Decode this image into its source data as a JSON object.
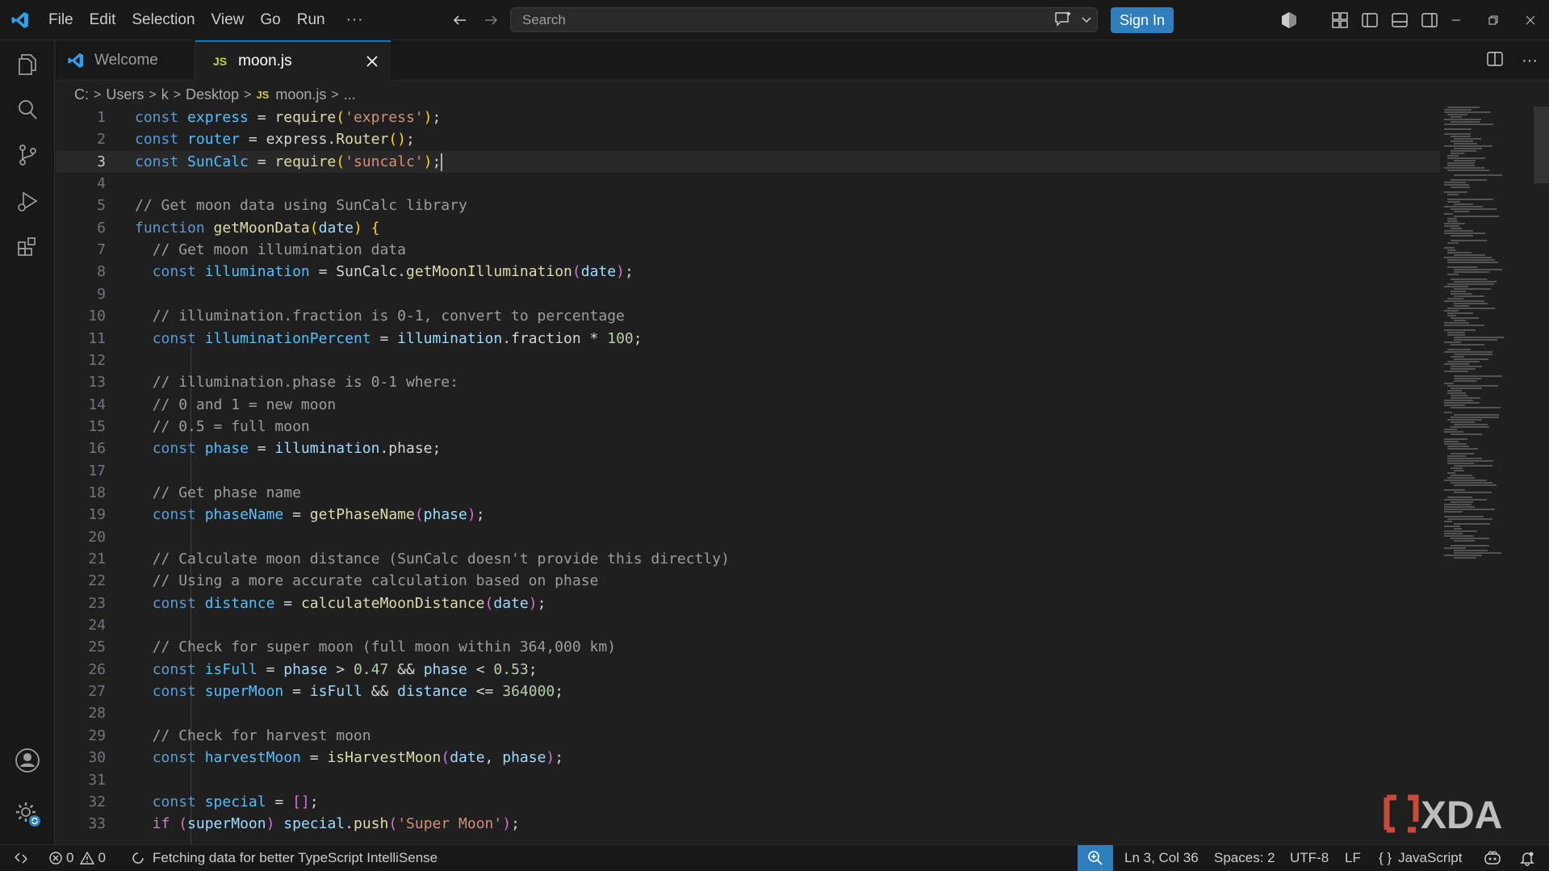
{
  "menu": {
    "items": [
      "File",
      "Edit",
      "Selection",
      "View",
      "Go",
      "Run"
    ],
    "more": "···"
  },
  "search": {
    "placeholder": "Search"
  },
  "signin_label": "Sign In",
  "tabs": {
    "welcome": {
      "label": "Welcome"
    },
    "active": {
      "label": "moon.js",
      "badge": "JS"
    }
  },
  "breadcrumb": {
    "parts": [
      "C:",
      "Users",
      "k",
      "Desktop"
    ],
    "file": "moon.js",
    "file_badge": "JS",
    "trail": "..."
  },
  "editor": {
    "current_line": 3,
    "lines": [
      [
        [
          "kw",
          "const "
        ],
        [
          "var",
          "express"
        ],
        [
          "pl",
          " = "
        ],
        [
          "fn",
          "require"
        ],
        [
          "br",
          "("
        ],
        [
          "str",
          "'express'"
        ],
        [
          "br",
          ")"
        ],
        [
          "pl",
          ";"
        ]
      ],
      [
        [
          "kw",
          "const "
        ],
        [
          "var",
          "router"
        ],
        [
          "pl",
          " = express."
        ],
        [
          "fn",
          "Router"
        ],
        [
          "br",
          "()"
        ],
        [
          "pl",
          ";"
        ]
      ],
      [
        [
          "kw",
          "const "
        ],
        [
          "var",
          "SunCalc"
        ],
        [
          "pl",
          " = "
        ],
        [
          "fn",
          "require"
        ],
        [
          "br",
          "("
        ],
        [
          "str",
          "'suncalc'"
        ],
        [
          "br",
          ")"
        ],
        [
          "pl",
          ";"
        ]
      ],
      [],
      [
        [
          "cm",
          "// Get moon data using SunCalc library"
        ]
      ],
      [
        [
          "kw",
          "function "
        ],
        [
          "fn",
          "getMoonData"
        ],
        [
          "br",
          "("
        ],
        [
          "prop",
          "date"
        ],
        [
          "br",
          ") {"
        ]
      ],
      [
        [
          "pl",
          "  "
        ],
        [
          "cm",
          "// Get moon illumination data"
        ]
      ],
      [
        [
          "pl",
          "  "
        ],
        [
          "kw",
          "const "
        ],
        [
          "var",
          "illumination"
        ],
        [
          "pl",
          " = SunCalc."
        ],
        [
          "fn",
          "getMoonIllumination"
        ],
        [
          "br2",
          "("
        ],
        [
          "prop",
          "date"
        ],
        [
          "br2",
          ")"
        ],
        [
          "pl",
          ";"
        ]
      ],
      [],
      [
        [
          "pl",
          "  "
        ],
        [
          "cm",
          "// illumination.fraction is 0-1, convert to percentage"
        ]
      ],
      [
        [
          "pl",
          "  "
        ],
        [
          "kw",
          "const "
        ],
        [
          "var",
          "illuminationPercent"
        ],
        [
          "pl",
          " = "
        ],
        [
          "prop",
          "illumination"
        ],
        [
          "pl",
          ".fraction * "
        ],
        [
          "num",
          "100"
        ],
        [
          "pl",
          ";"
        ]
      ],
      [],
      [
        [
          "pl",
          "  "
        ],
        [
          "cm",
          "// illumination.phase is 0-1 where:"
        ]
      ],
      [
        [
          "pl",
          "  "
        ],
        [
          "cm",
          "// 0 and 1 = new moon"
        ]
      ],
      [
        [
          "pl",
          "  "
        ],
        [
          "cm",
          "// 0.5 = full moon"
        ]
      ],
      [
        [
          "pl",
          "  "
        ],
        [
          "kw",
          "const "
        ],
        [
          "var",
          "phase"
        ],
        [
          "pl",
          " = "
        ],
        [
          "prop",
          "illumination"
        ],
        [
          "pl",
          ".phase;"
        ]
      ],
      [],
      [
        [
          "pl",
          "  "
        ],
        [
          "cm",
          "// Get phase name"
        ]
      ],
      [
        [
          "pl",
          "  "
        ],
        [
          "kw",
          "const "
        ],
        [
          "var",
          "phaseName"
        ],
        [
          "pl",
          " = "
        ],
        [
          "fn",
          "getPhaseName"
        ],
        [
          "br2",
          "("
        ],
        [
          "prop",
          "phase"
        ],
        [
          "br2",
          ")"
        ],
        [
          "pl",
          ";"
        ]
      ],
      [],
      [
        [
          "pl",
          "  "
        ],
        [
          "cm",
          "// Calculate moon distance (SunCalc doesn't provide this directly)"
        ]
      ],
      [
        [
          "pl",
          "  "
        ],
        [
          "cm",
          "// Using a more accurate calculation based on phase"
        ]
      ],
      [
        [
          "pl",
          "  "
        ],
        [
          "kw",
          "const "
        ],
        [
          "var",
          "distance"
        ],
        [
          "pl",
          " = "
        ],
        [
          "fn",
          "calculateMoonDistance"
        ],
        [
          "br2",
          "("
        ],
        [
          "prop",
          "date"
        ],
        [
          "br2",
          ")"
        ],
        [
          "pl",
          ";"
        ]
      ],
      [],
      [
        [
          "pl",
          "  "
        ],
        [
          "cm",
          "// Check for super moon (full moon within 364,000 km)"
        ]
      ],
      [
        [
          "pl",
          "  "
        ],
        [
          "kw",
          "const "
        ],
        [
          "var",
          "isFull"
        ],
        [
          "pl",
          " = "
        ],
        [
          "prop",
          "phase"
        ],
        [
          "pl",
          " > "
        ],
        [
          "num",
          "0.47"
        ],
        [
          "pl",
          " && "
        ],
        [
          "prop",
          "phase"
        ],
        [
          "pl",
          " < "
        ],
        [
          "num",
          "0.53"
        ],
        [
          "pl",
          ";"
        ]
      ],
      [
        [
          "pl",
          "  "
        ],
        [
          "kw",
          "const "
        ],
        [
          "var",
          "superMoon"
        ],
        [
          "pl",
          " = "
        ],
        [
          "prop",
          "isFull"
        ],
        [
          "pl",
          " && "
        ],
        [
          "prop",
          "distance"
        ],
        [
          "pl",
          " <= "
        ],
        [
          "num",
          "364000"
        ],
        [
          "pl",
          ";"
        ]
      ],
      [],
      [
        [
          "pl",
          "  "
        ],
        [
          "cm",
          "// Check for harvest moon"
        ]
      ],
      [
        [
          "pl",
          "  "
        ],
        [
          "kw",
          "const "
        ],
        [
          "var",
          "harvestMoon"
        ],
        [
          "pl",
          " = "
        ],
        [
          "fn",
          "isHarvestMoon"
        ],
        [
          "br2",
          "("
        ],
        [
          "prop",
          "date"
        ],
        [
          "pl",
          ", "
        ],
        [
          "prop",
          "phase"
        ],
        [
          "br2",
          ")"
        ],
        [
          "pl",
          ";"
        ]
      ],
      [],
      [
        [
          "pl",
          "  "
        ],
        [
          "kw",
          "const "
        ],
        [
          "var",
          "special"
        ],
        [
          "pl",
          " = "
        ],
        [
          "br2",
          "[]"
        ],
        [
          "pl",
          ";"
        ]
      ],
      [
        [
          "pl",
          "  "
        ],
        [
          "kw2",
          "if "
        ],
        [
          "br2",
          "("
        ],
        [
          "prop",
          "superMoon"
        ],
        [
          "br2",
          ")"
        ],
        [
          "pl",
          " "
        ],
        [
          "prop",
          "special"
        ],
        [
          "pl",
          "."
        ],
        [
          "fn",
          "push"
        ],
        [
          "br2",
          "("
        ],
        [
          "str",
          "'Super Moon'"
        ],
        [
          "br2",
          ")"
        ],
        [
          "pl",
          ";"
        ]
      ]
    ]
  },
  "statusbar": {
    "errors": "0",
    "warnings": "0",
    "message": "Fetching data for better TypeScript IntelliSense",
    "position": "Ln 3, Col 36",
    "spaces": "Spaces: 2",
    "encoding": "UTF-8",
    "eol": "LF",
    "language": "JavaScript",
    "language_icon": "{ }"
  },
  "watermark": "XDA",
  "colors": {
    "accent": "#0078d4",
    "signin": "#2f7fbf",
    "js_badge": "#cbcb41",
    "background": "#1f1f1f",
    "chrome": "#181818"
  },
  "icons": {
    "activity": [
      "explorer-icon",
      "search-icon",
      "source-control-icon",
      "run-debug-icon",
      "extensions-icon",
      "accounts-icon",
      "manage-gear-icon"
    ]
  }
}
